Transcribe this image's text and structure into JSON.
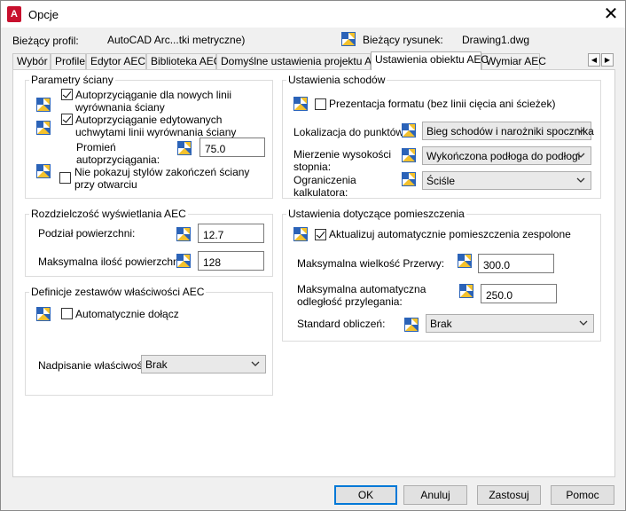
{
  "title_bar": {
    "app_icon_letter": "A",
    "title": "Opcje"
  },
  "header": {
    "profile_label": "Bieżący profil:",
    "profile_value": "AutoCAD Arc...tki metryczne)",
    "drawing_label": "Bieżący rysunek:",
    "drawing_value": "Drawing1.dwg"
  },
  "tabs": [
    {
      "label": "Wybór"
    },
    {
      "label": "Profile"
    },
    {
      "label": "Edytor AEC"
    },
    {
      "label": "Biblioteka AEC"
    },
    {
      "label": "Domyślne ustawienia projektu AEC"
    },
    {
      "label": "Ustawienia obiektu AEC",
      "active": true
    },
    {
      "label": "Wymiar AEC"
    }
  ],
  "wall_params": {
    "title": "Parametry ściany",
    "snap_new": {
      "label": "Autoprzyciąganie dla nowych linii wyrównania ściany",
      "checked": true
    },
    "snap_edit": {
      "label": "Autoprzyciąganie edytowanych uchwytami linii wyrównania ściany",
      "checked": true
    },
    "radius_label": "Promień autoprzyciągania:",
    "radius_value": "75.0",
    "no_end_styles": {
      "label": "Nie pokazuj stylów zakończeń ściany przy otwarciu",
      "checked": false
    }
  },
  "display_res": {
    "title": "Rozdzielczość wyświetlania AEC",
    "division_label": "Podział powierzchni:",
    "division_value": "12.7",
    "max_surfaces_label": "Maksymalna ilość powierzchni:",
    "max_surfaces_value": "128"
  },
  "property_sets": {
    "title": "Definicje zestawów właściwości AEC",
    "auto_attach": {
      "label": "Automatycznie dołącz",
      "checked": false
    },
    "override_label": "Nadpisanie właściwości",
    "override_value": "Brak"
  },
  "stairs": {
    "title": "Ustawienia schodów",
    "format_presentation": {
      "label": "Prezentacja formatu (bez linii cięcia ani ścieżek)",
      "checked": false
    },
    "location_label": "Lokalizacja do punktów:",
    "location_value": "Bieg schodów i narożniki spocznika",
    "riser_label": "Mierzenie wysokości stopnia:",
    "riser_value": "Wykończona podłoga do podłogi",
    "calc_limits_label": "Ograniczenia kalkulatora:",
    "calc_limits_value": "Ściśle"
  },
  "spaces": {
    "title": "Ustawienia dotyczące pomieszczenia",
    "auto_update": {
      "label": "Aktualizuj automatycznie pomieszczenia zespolone",
      "checked": true
    },
    "max_gap_label": "Maksymalna wielkość Przerwy:",
    "max_gap_value": "300.0",
    "max_adj_label": "Maksymalna automatyczna odległość przylegania:",
    "max_adj_value": "250.0",
    "calc_std_label": "Standard obliczeń:",
    "calc_std_value": "Brak"
  },
  "buttons": {
    "ok": "OK",
    "cancel": "Anuluj",
    "apply": "Zastosuj",
    "help": "Pomoc"
  },
  "colors": {
    "accent": "#0078d7",
    "app_red": "#c8102e",
    "cube_blue": "#2b63b8",
    "cube_yellow": "#f3c12d"
  }
}
